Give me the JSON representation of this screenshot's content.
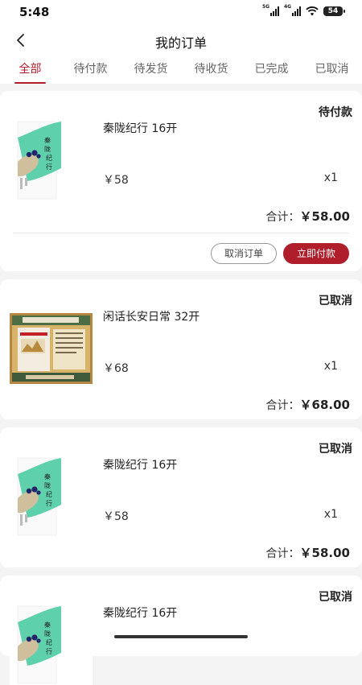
{
  "status_bar": {
    "time": "5:48",
    "battery": "54",
    "network_1": "5G",
    "network_2": "4G"
  },
  "header": {
    "title": "我的订单"
  },
  "tabs": [
    {
      "label": "全部",
      "active": true
    },
    {
      "label": "待付款",
      "active": false
    },
    {
      "label": "待发货",
      "active": false
    },
    {
      "label": "待收货",
      "active": false
    },
    {
      "label": "已完成",
      "active": false
    },
    {
      "label": "已取消",
      "active": false
    }
  ],
  "orders": [
    {
      "status": "待付款",
      "product": "秦陇纪行 16开",
      "price": "￥58",
      "qty": "x1",
      "total_label": "合计：",
      "total": "￥58.00",
      "cover": "qinlong-cover",
      "cancel_label": "取消订单",
      "pay_label": "立即付款"
    },
    {
      "status": "已取消",
      "product": "闲话长安日常 32开",
      "price": "￥68",
      "qty": "x1",
      "total_label": "合计：",
      "total": "￥68.00",
      "cover": "changan-cover"
    },
    {
      "status": "已取消",
      "product": "秦陇纪行 16开",
      "price": "￥58",
      "qty": "x1",
      "total_label": "合计：",
      "total": "￥58.00",
      "cover": "qinlong-cover"
    },
    {
      "status": "已取消",
      "product": "秦陇纪行 16开",
      "cover": "qinlong-cover"
    }
  ],
  "colors": {
    "accent": "#b01e2b",
    "background": "#f4f4f4",
    "card": "#ffffff"
  }
}
